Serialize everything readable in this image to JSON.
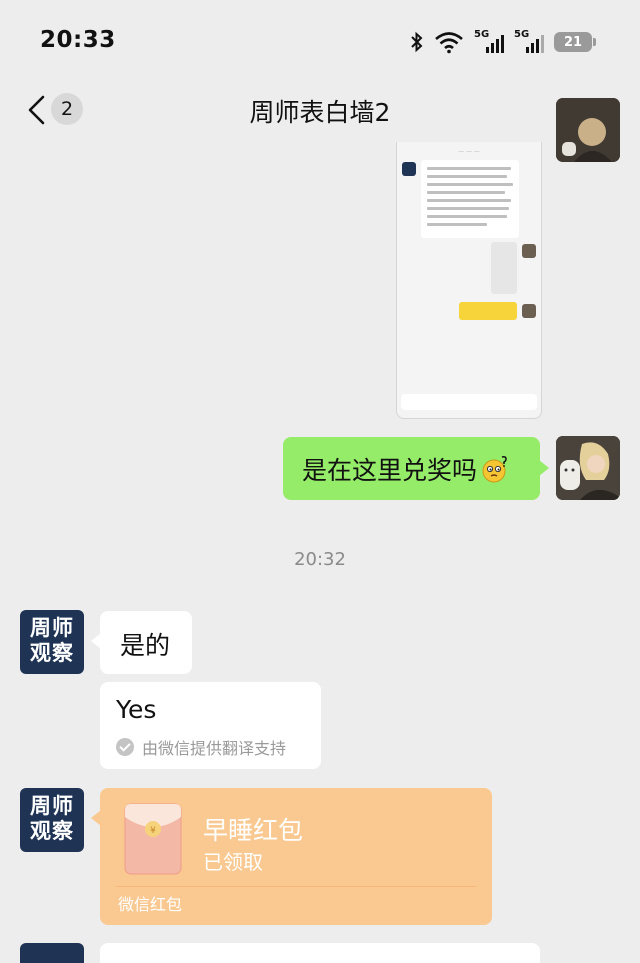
{
  "status_bar": {
    "time": "20:33",
    "battery": "21",
    "signal_tag_1": "5G",
    "signal_tag_2": "5G"
  },
  "nav": {
    "unread_count": "2",
    "title": "周师表白墙2"
  },
  "messages": {
    "sent_text": "是在这里兑奖吗",
    "timestamp": "20:32",
    "reply_text": "是的",
    "translation_text": "Yes",
    "translation_note": "由微信提供翻译支持",
    "avatar_line1": "周师",
    "avatar_line2": "观察"
  },
  "red_packet": {
    "title": "早睡红包",
    "status": "已领取",
    "label": "微信红包",
    "color": "#f9c991"
  },
  "colors": {
    "background": "#ededed",
    "sent_bubble": "#95ec69",
    "logo_avatar": "#1f3354"
  }
}
